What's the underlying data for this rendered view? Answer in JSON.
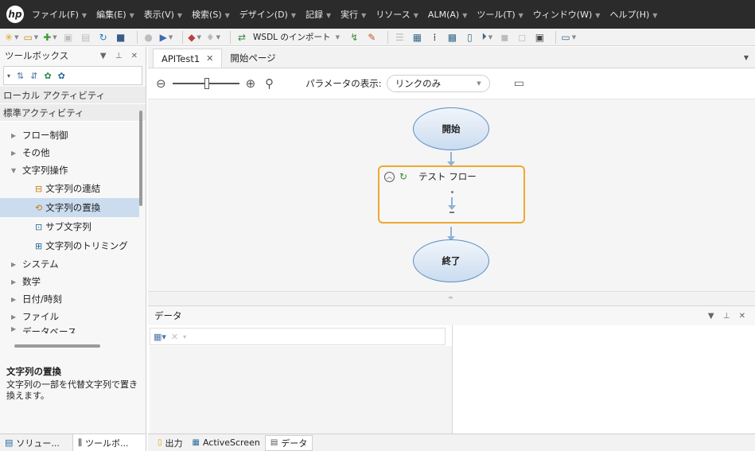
{
  "menubar": {
    "items": [
      "ファイル(F)",
      "編集(E)",
      "表示(V)",
      "検索(S)",
      "デザイン(D)",
      "記録",
      "実行",
      "リソース",
      "ALM(A)",
      "ツール(T)",
      "ウィンドウ(W)",
      "ヘルプ(H)"
    ]
  },
  "toolbar": {
    "wsdl_label": "WSDL のインポート"
  },
  "toolbox": {
    "title": "ツールボックス",
    "sections": [
      "ローカル アクティビティ",
      "標準アクティビティ"
    ],
    "tree": {
      "flow": "フロー制御",
      "other": "その他",
      "string": "文字列操作",
      "leaves": [
        "文字列の連結",
        "文字列の置換",
        "サブ文字列",
        "文字列のトリミング"
      ],
      "system": "システム",
      "math": "数学",
      "datetime": "日付/時刻",
      "file": "ファイル",
      "cutoff": "データベース"
    },
    "description": {
      "title": "文字列の置換",
      "body": "文字列の一部を代替文字列で置き換えます。"
    },
    "tabs": [
      "ソリュー...",
      "ツールボ..."
    ]
  },
  "editor": {
    "tabs": [
      "APITest1",
      "開始ページ"
    ],
    "param_label": "パラメータの表示:",
    "param_value": "リンクのみ",
    "start_label": "開始",
    "group_label": "テスト フロー",
    "end_label": "終了"
  },
  "data_panel": {
    "title": "データ"
  },
  "bottom_tabs": [
    "出力",
    "ActiveScreen",
    "データ"
  ],
  "colors": {
    "menubar_bg": "#2b2b2b",
    "selection": "#cbdcef",
    "group_border": "#f0a830",
    "oval_border": "#5a8ec4"
  }
}
